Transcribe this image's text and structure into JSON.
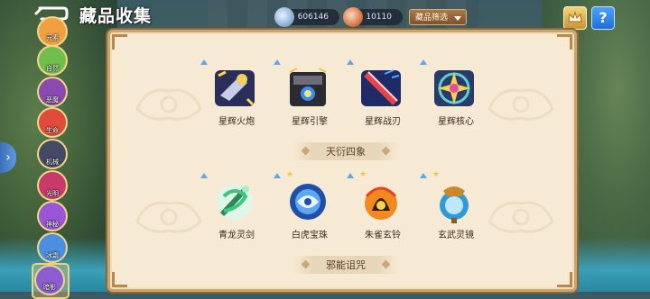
{
  "header": {
    "title": "藏品收集",
    "resource_1": "606146",
    "resource_2": "10110",
    "filter_label": "藏品筛选"
  },
  "sidebar": {
    "items": [
      {
        "label": "元素",
        "color": "#f0a040"
      },
      {
        "label": "自然",
        "color": "#6fbf4a"
      },
      {
        "label": "恶魔",
        "color": "#8a4ab0"
      },
      {
        "label": "生命",
        "color": "#e04b3a"
      },
      {
        "label": "机械",
        "color": "#444a66"
      },
      {
        "label": "光明",
        "color": "#c83a6a"
      },
      {
        "label": "神秘",
        "color": "#9a55d8"
      },
      {
        "label": "冰霜",
        "color": "#4a8fe0"
      },
      {
        "label": "暗影",
        "color": "#8a5ed0"
      }
    ]
  },
  "collection": {
    "group_1_items": [
      "星辉火炮",
      "星辉引擎",
      "星辉战刃",
      "星辉核心"
    ],
    "section_2_title": "天衍四象",
    "group_2_items": [
      "青龙灵剑",
      "白虎宝珠",
      "朱雀玄铃",
      "玄武灵镜"
    ],
    "section_3_title": "邪能诅咒"
  },
  "colors": {
    "panel_bg": "#f7ead4",
    "panel_border": "#caa56d",
    "accent_blue": "#62a6e8",
    "star_gold": "#f4c542"
  }
}
